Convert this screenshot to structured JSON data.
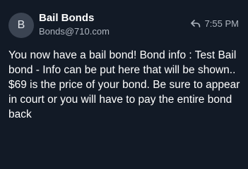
{
  "sender": {
    "avatar_initial": "B",
    "name": "Bail Bonds",
    "email": "Bonds@710.com"
  },
  "message": {
    "time": "7:55 PM",
    "reply_icon": "reply-arrow-icon",
    "paragraph_1": "You now have a bail bond! Bond info : Test Bail bond - Info can be put here that will be shown..",
    "paragraph_2": "$69 is the price of your bond. Be sure to appear in court or you will have to pay the entire bond back"
  },
  "colors": {
    "background": "#121a26",
    "avatar_bg": "#3b4452",
    "muted_text": "#aeb5bf",
    "text": "#ffffff"
  }
}
